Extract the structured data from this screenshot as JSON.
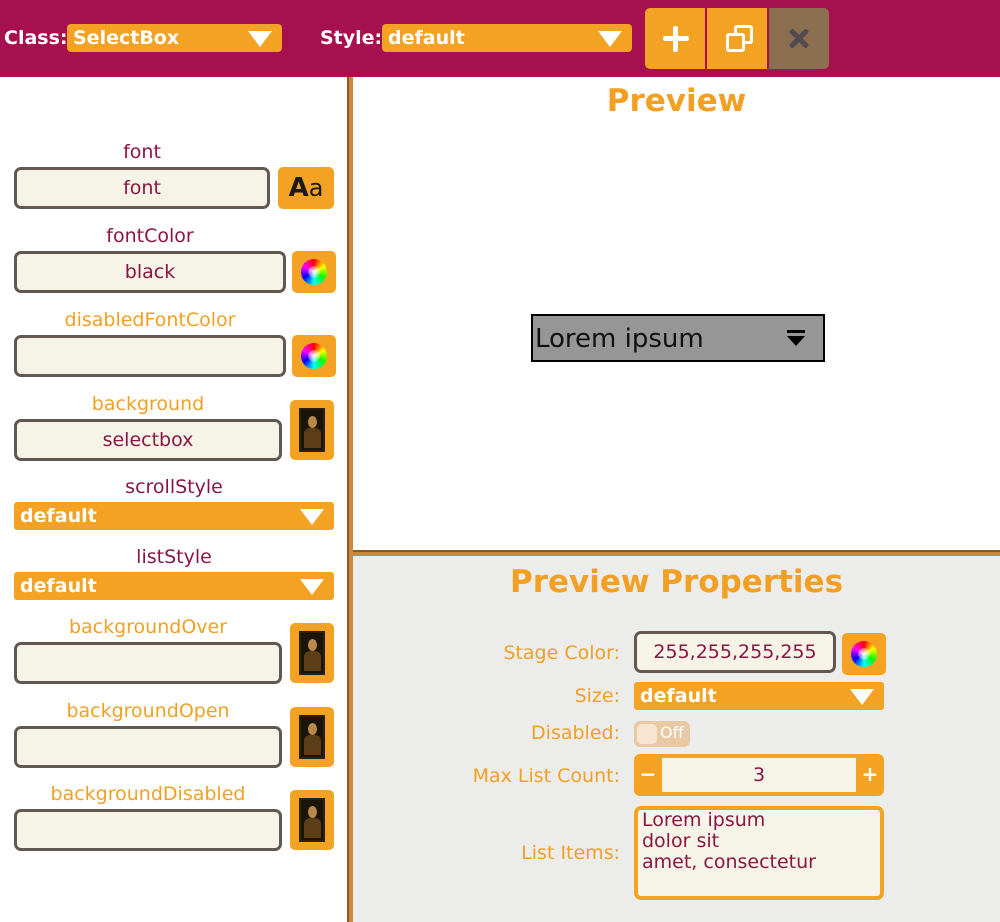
{
  "toolbar": {
    "class_label": "Class:",
    "class_value": "SelectBox",
    "style_label": "Style:",
    "style_value": "default",
    "buttons": [
      "plus-icon",
      "duplicate-icon",
      "close-icon"
    ]
  },
  "style_properties": {
    "font": {
      "label": "font",
      "value": "font",
      "button": "Aa"
    },
    "fontColor": {
      "label": "fontColor",
      "value": "black"
    },
    "disabledFontColor": {
      "label": "disabledFontColor",
      "value": ""
    },
    "background": {
      "label": "background",
      "value": "selectbox"
    },
    "scrollStyle": {
      "label": "scrollStyle",
      "value": "default"
    },
    "listStyle": {
      "label": "listStyle",
      "value": "default"
    },
    "backgroundOver": {
      "label": "backgroundOver",
      "value": ""
    },
    "backgroundOpen": {
      "label": "backgroundOpen",
      "value": ""
    },
    "backgroundDisabled": {
      "label": "backgroundDisabled",
      "value": ""
    }
  },
  "preview": {
    "title": "Preview",
    "selectbox_text": "Lorem ipsum"
  },
  "preview_properties": {
    "title": "Preview Properties",
    "stage_color_label": "Stage Color:",
    "stage_color_value": "255,255,255,255",
    "size_label": "Size:",
    "size_value": "default",
    "disabled_label": "Disabled:",
    "disabled_value": "Off",
    "max_list_count_label": "Max List Count:",
    "max_list_count_value": "3",
    "list_items_label": "List Items:",
    "list_items": [
      "Lorem ipsum",
      "dolor sit",
      "amet, consectetur"
    ]
  },
  "colors": {
    "toolbar": "#a6104e",
    "accent": "#f4a223",
    "label_maroon": "#8a1645",
    "label_orange": "#f2a024",
    "field_bg": "#f5f4e6",
    "divider": "#c9893a"
  }
}
